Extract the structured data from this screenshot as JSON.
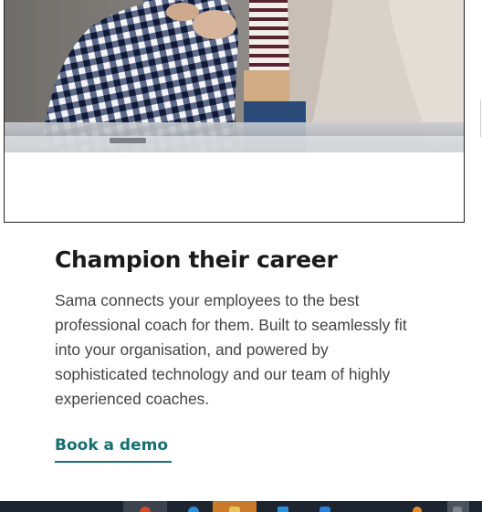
{
  "hero": {
    "image_alt": "Person in checked shirt with colleague at a desk"
  },
  "section": {
    "heading": "Champion their career",
    "body": "Sama connects your employees to the best professional coach for them. Built to seamlessly fit into your organisation, and powered by sophisticated technology and our team of highly experienced coaches.",
    "cta_label": "Book a demo"
  },
  "colors": {
    "accent": "#16706f",
    "heading": "#1a1a1a",
    "body": "#444444",
    "taskbar": "#1c2530"
  },
  "taskbar": {
    "apps": [
      {
        "icon": "browser-red-icon",
        "state": "active",
        "color": "#d04a2a"
      },
      {
        "icon": "edge-icon",
        "state": "normal",
        "color": "#2a8fd8"
      },
      {
        "icon": "file-explorer-icon",
        "state": "highlighted",
        "color": "#e8c25a"
      },
      {
        "icon": "mail-icon",
        "state": "normal",
        "color": "#2a8fd8"
      },
      {
        "icon": "store-icon",
        "state": "normal",
        "color": "#2a7fd8"
      },
      {
        "icon": "user-icon",
        "state": "normal",
        "color": "#e08a2a"
      },
      {
        "icon": "show-desktop-icon",
        "state": "normal",
        "color": "#cccccc"
      }
    ]
  }
}
